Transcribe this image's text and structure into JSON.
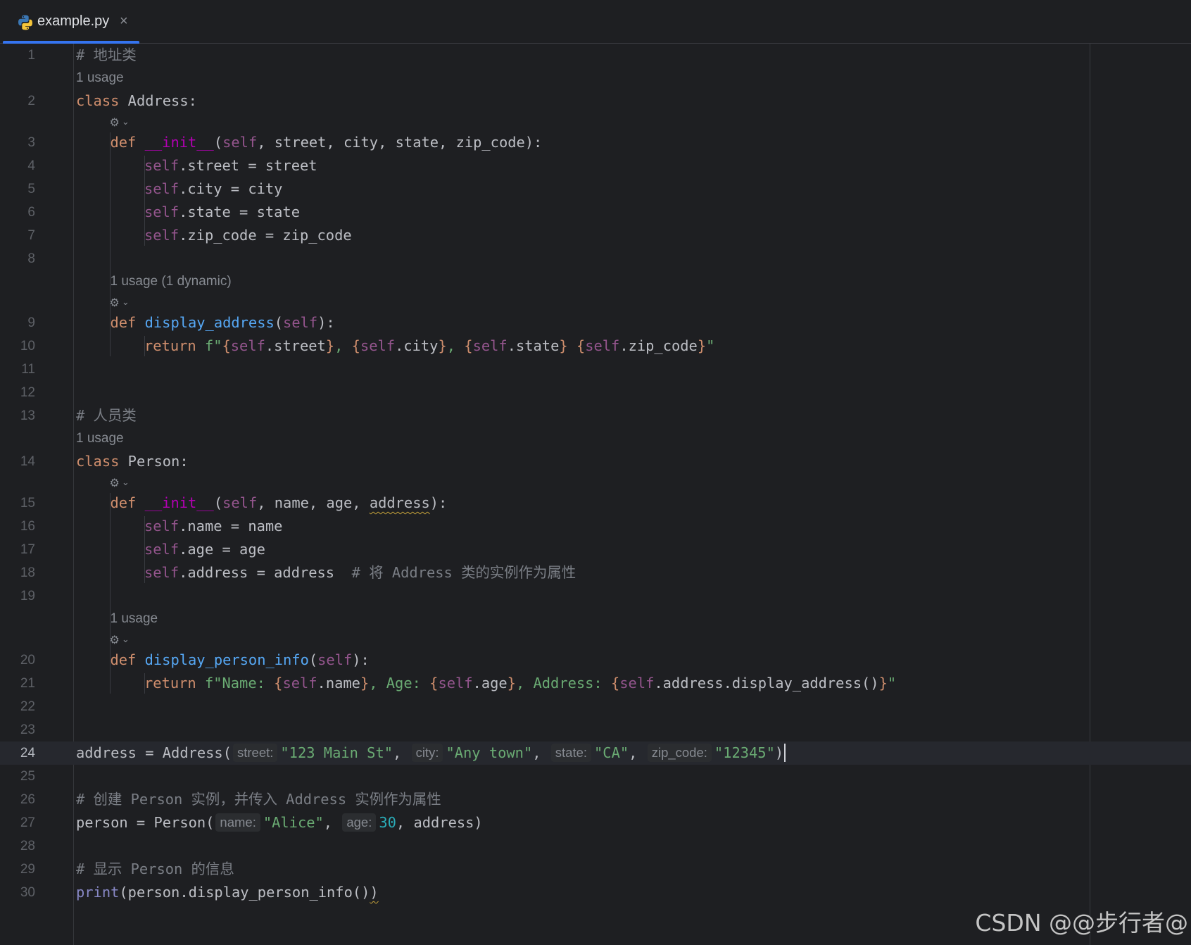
{
  "tab": {
    "title": "example.py",
    "close": "×"
  },
  "lines": [
    {
      "n": "1",
      "indent": 0,
      "parts": [
        [
          "cmt",
          "# 地址类"
        ]
      ]
    },
    {
      "n": "2",
      "indent": 0,
      "parts": [
        [
          "kw",
          "class "
        ],
        [
          "",
          "Address:"
        ]
      ]
    },
    {
      "n": "3",
      "indent": 1,
      "parts": [
        [
          "kw",
          "def "
        ],
        [
          "dunder",
          "__init__"
        ],
        [
          "",
          "("
        ],
        [
          "self",
          "self"
        ],
        [
          "",
          ", street, city, state, zip_code):"
        ]
      ]
    },
    {
      "n": "4",
      "indent": 2,
      "parts": [
        [
          "self",
          "self"
        ],
        [
          "",
          ".street = street"
        ]
      ]
    },
    {
      "n": "5",
      "indent": 2,
      "parts": [
        [
          "self",
          "self"
        ],
        [
          "",
          ".city = city"
        ]
      ]
    },
    {
      "n": "6",
      "indent": 2,
      "parts": [
        [
          "self",
          "self"
        ],
        [
          "",
          ".state = state"
        ]
      ]
    },
    {
      "n": "7",
      "indent": 2,
      "parts": [
        [
          "self",
          "self"
        ],
        [
          "",
          ".zip_code = zip_code"
        ]
      ]
    },
    {
      "n": "8",
      "indent": 0,
      "parts": []
    },
    {
      "n": "9",
      "indent": 1,
      "parts": [
        [
          "kw",
          "def "
        ],
        [
          "fn",
          "display_address"
        ],
        [
          "",
          "("
        ],
        [
          "self",
          "self"
        ],
        [
          "",
          "):"
        ]
      ]
    },
    {
      "n": "10",
      "indent": 2,
      "parts": [
        [
          "kw",
          "return "
        ],
        [
          "str",
          "f\""
        ],
        [
          "kw",
          "{"
        ],
        [
          "self",
          "self"
        ],
        [
          "",
          ".street"
        ],
        [
          "kw",
          "}"
        ],
        [
          "str",
          ", "
        ],
        [
          "kw",
          "{"
        ],
        [
          "self",
          "self"
        ],
        [
          "",
          ".city"
        ],
        [
          "kw",
          "}"
        ],
        [
          "str",
          ", "
        ],
        [
          "kw",
          "{"
        ],
        [
          "self",
          "self"
        ],
        [
          "",
          ".state"
        ],
        [
          "kw",
          "}"
        ],
        [
          "str",
          " "
        ],
        [
          "kw",
          "{"
        ],
        [
          "self",
          "self"
        ],
        [
          "",
          ".zip_code"
        ],
        [
          "kw",
          "}"
        ],
        [
          "str",
          "\""
        ]
      ]
    },
    {
      "n": "11",
      "indent": 0,
      "parts": []
    },
    {
      "n": "12",
      "indent": 0,
      "parts": []
    },
    {
      "n": "13",
      "indent": 0,
      "parts": [
        [
          "cmt",
          "# 人员类"
        ]
      ]
    },
    {
      "n": "14",
      "indent": 0,
      "parts": [
        [
          "kw",
          "class "
        ],
        [
          "",
          "Person:"
        ]
      ]
    },
    {
      "n": "15",
      "indent": 1,
      "parts": [
        [
          "kw",
          "def "
        ],
        [
          "dunder",
          "__init__"
        ],
        [
          "",
          "("
        ],
        [
          "self",
          "self"
        ],
        [
          "",
          ", name, age, "
        ],
        [
          "squig",
          "address"
        ],
        [
          "",
          "):"
        ]
      ]
    },
    {
      "n": "16",
      "indent": 2,
      "parts": [
        [
          "self",
          "self"
        ],
        [
          "",
          ".name = name"
        ]
      ]
    },
    {
      "n": "17",
      "indent": 2,
      "parts": [
        [
          "self",
          "self"
        ],
        [
          "",
          ".age = age"
        ]
      ]
    },
    {
      "n": "18",
      "indent": 2,
      "parts": [
        [
          "self",
          "self"
        ],
        [
          "",
          ".address = address  "
        ],
        [
          "cmt",
          "# 将 Address 类的实例作为属性"
        ]
      ]
    },
    {
      "n": "19",
      "indent": 0,
      "parts": []
    },
    {
      "n": "20",
      "indent": 1,
      "parts": [
        [
          "kw",
          "def "
        ],
        [
          "fn",
          "display_person_info"
        ],
        [
          "",
          "("
        ],
        [
          "self",
          "self"
        ],
        [
          "",
          "):"
        ]
      ]
    },
    {
      "n": "21",
      "indent": 2,
      "parts": [
        [
          "kw",
          "return "
        ],
        [
          "str",
          "f\"Name: "
        ],
        [
          "kw",
          "{"
        ],
        [
          "self",
          "self"
        ],
        [
          "",
          ".name"
        ],
        [
          "kw",
          "}"
        ],
        [
          "str",
          ", Age: "
        ],
        [
          "kw",
          "{"
        ],
        [
          "self",
          "self"
        ],
        [
          "",
          ".age"
        ],
        [
          "kw",
          "}"
        ],
        [
          "str",
          ", Address: "
        ],
        [
          "kw",
          "{"
        ],
        [
          "self",
          "self"
        ],
        [
          "",
          ".address.display_address()"
        ],
        [
          "kw",
          "}"
        ],
        [
          "str",
          "\""
        ]
      ]
    },
    {
      "n": "22",
      "indent": 0,
      "parts": []
    },
    {
      "n": "23",
      "indent": 0,
      "parts": []
    },
    {
      "n": "24",
      "indent": 0,
      "current": true,
      "parts": [
        [
          "",
          "address = Address("
        ],
        [
          "hint",
          "street:"
        ],
        [
          "str",
          "\"123 Main St\""
        ],
        [
          "",
          ", "
        ],
        [
          "hint",
          "city:"
        ],
        [
          "str",
          "\"Any town\""
        ],
        [
          "",
          ", "
        ],
        [
          "hint",
          "state:"
        ],
        [
          "str",
          "\"CA\""
        ],
        [
          "",
          ", "
        ],
        [
          "hint",
          "zip_code:"
        ],
        [
          "str",
          "\"12345\""
        ],
        [
          "",
          ")"
        ],
        [
          "caret",
          ""
        ]
      ]
    },
    {
      "n": "25",
      "indent": 0,
      "parts": []
    },
    {
      "n": "26",
      "indent": 0,
      "parts": [
        [
          "cmt",
          "# 创建 Person 实例，并传入 Address 实例作为属性"
        ]
      ]
    },
    {
      "n": "27",
      "indent": 0,
      "parts": [
        [
          "",
          "person = Person("
        ],
        [
          "hint",
          "name:"
        ],
        [
          "str",
          "\"Alice\""
        ],
        [
          "",
          ", "
        ],
        [
          "hint",
          "age:"
        ],
        [
          "num",
          "30"
        ],
        [
          "",
          ", address)"
        ]
      ]
    },
    {
      "n": "28",
      "indent": 0,
      "parts": []
    },
    {
      "n": "29",
      "indent": 0,
      "parts": [
        [
          "cmt",
          "# 显示 Person 的信息"
        ]
      ]
    },
    {
      "n": "30",
      "indent": 0,
      "parts": [
        [
          "bi",
          "print"
        ],
        [
          "",
          "(person.display_person_info()"
        ],
        [
          "squig",
          ")"
        ]
      ]
    }
  ],
  "lenses": [
    {
      "before": "2",
      "indent": 0,
      "text": "1 usage",
      "gear": false
    },
    {
      "before": "3",
      "indent": 1,
      "text": "",
      "gear": true
    },
    {
      "before": "9",
      "indent": 1,
      "text": "1 usage (1 dynamic)",
      "gear": true
    },
    {
      "before": "14",
      "indent": 0,
      "text": "1 usage",
      "gear": false
    },
    {
      "before": "15",
      "indent": 1,
      "text": "",
      "gear": true
    },
    {
      "before": "20",
      "indent": 1,
      "text": "1 usage",
      "gear": true
    }
  ],
  "icons": {
    "gear": "⚙",
    "chevron": "⌄"
  },
  "watermark": "CSDN @@步行者@"
}
